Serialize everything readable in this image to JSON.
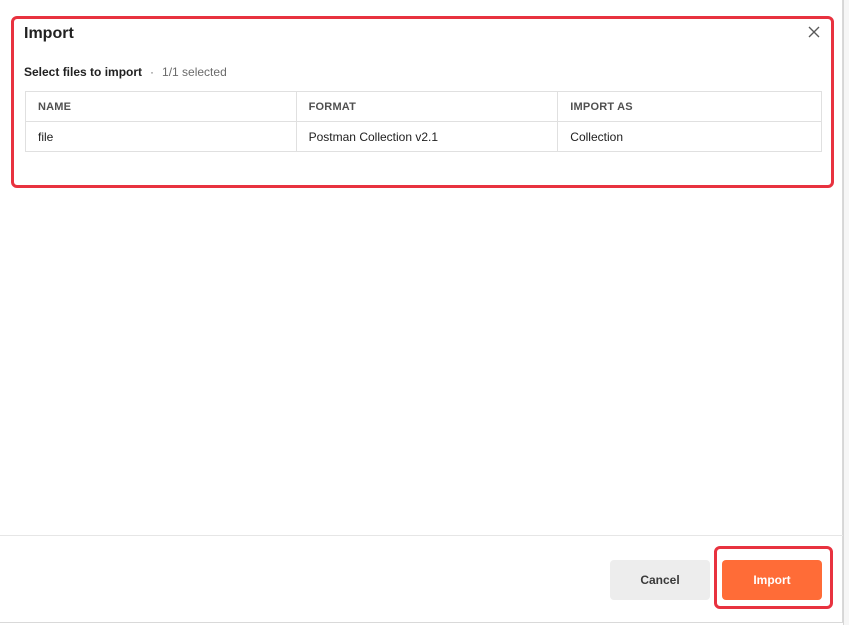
{
  "dialog": {
    "title": "Import",
    "close_icon": "close-icon"
  },
  "selection": {
    "label": "Select files to import",
    "separator": "·",
    "count": "1/1 selected"
  },
  "table": {
    "headers": [
      "NAME",
      "FORMAT",
      "IMPORT AS"
    ],
    "rows": [
      [
        "file",
        "Postman Collection v2.1",
        "Collection"
      ]
    ]
  },
  "footer": {
    "cancel_label": "Cancel",
    "import_label": "Import"
  },
  "colors": {
    "accent": "#ff6c37",
    "highlight": "#e8323f",
    "cancel_bg": "#ededed"
  }
}
